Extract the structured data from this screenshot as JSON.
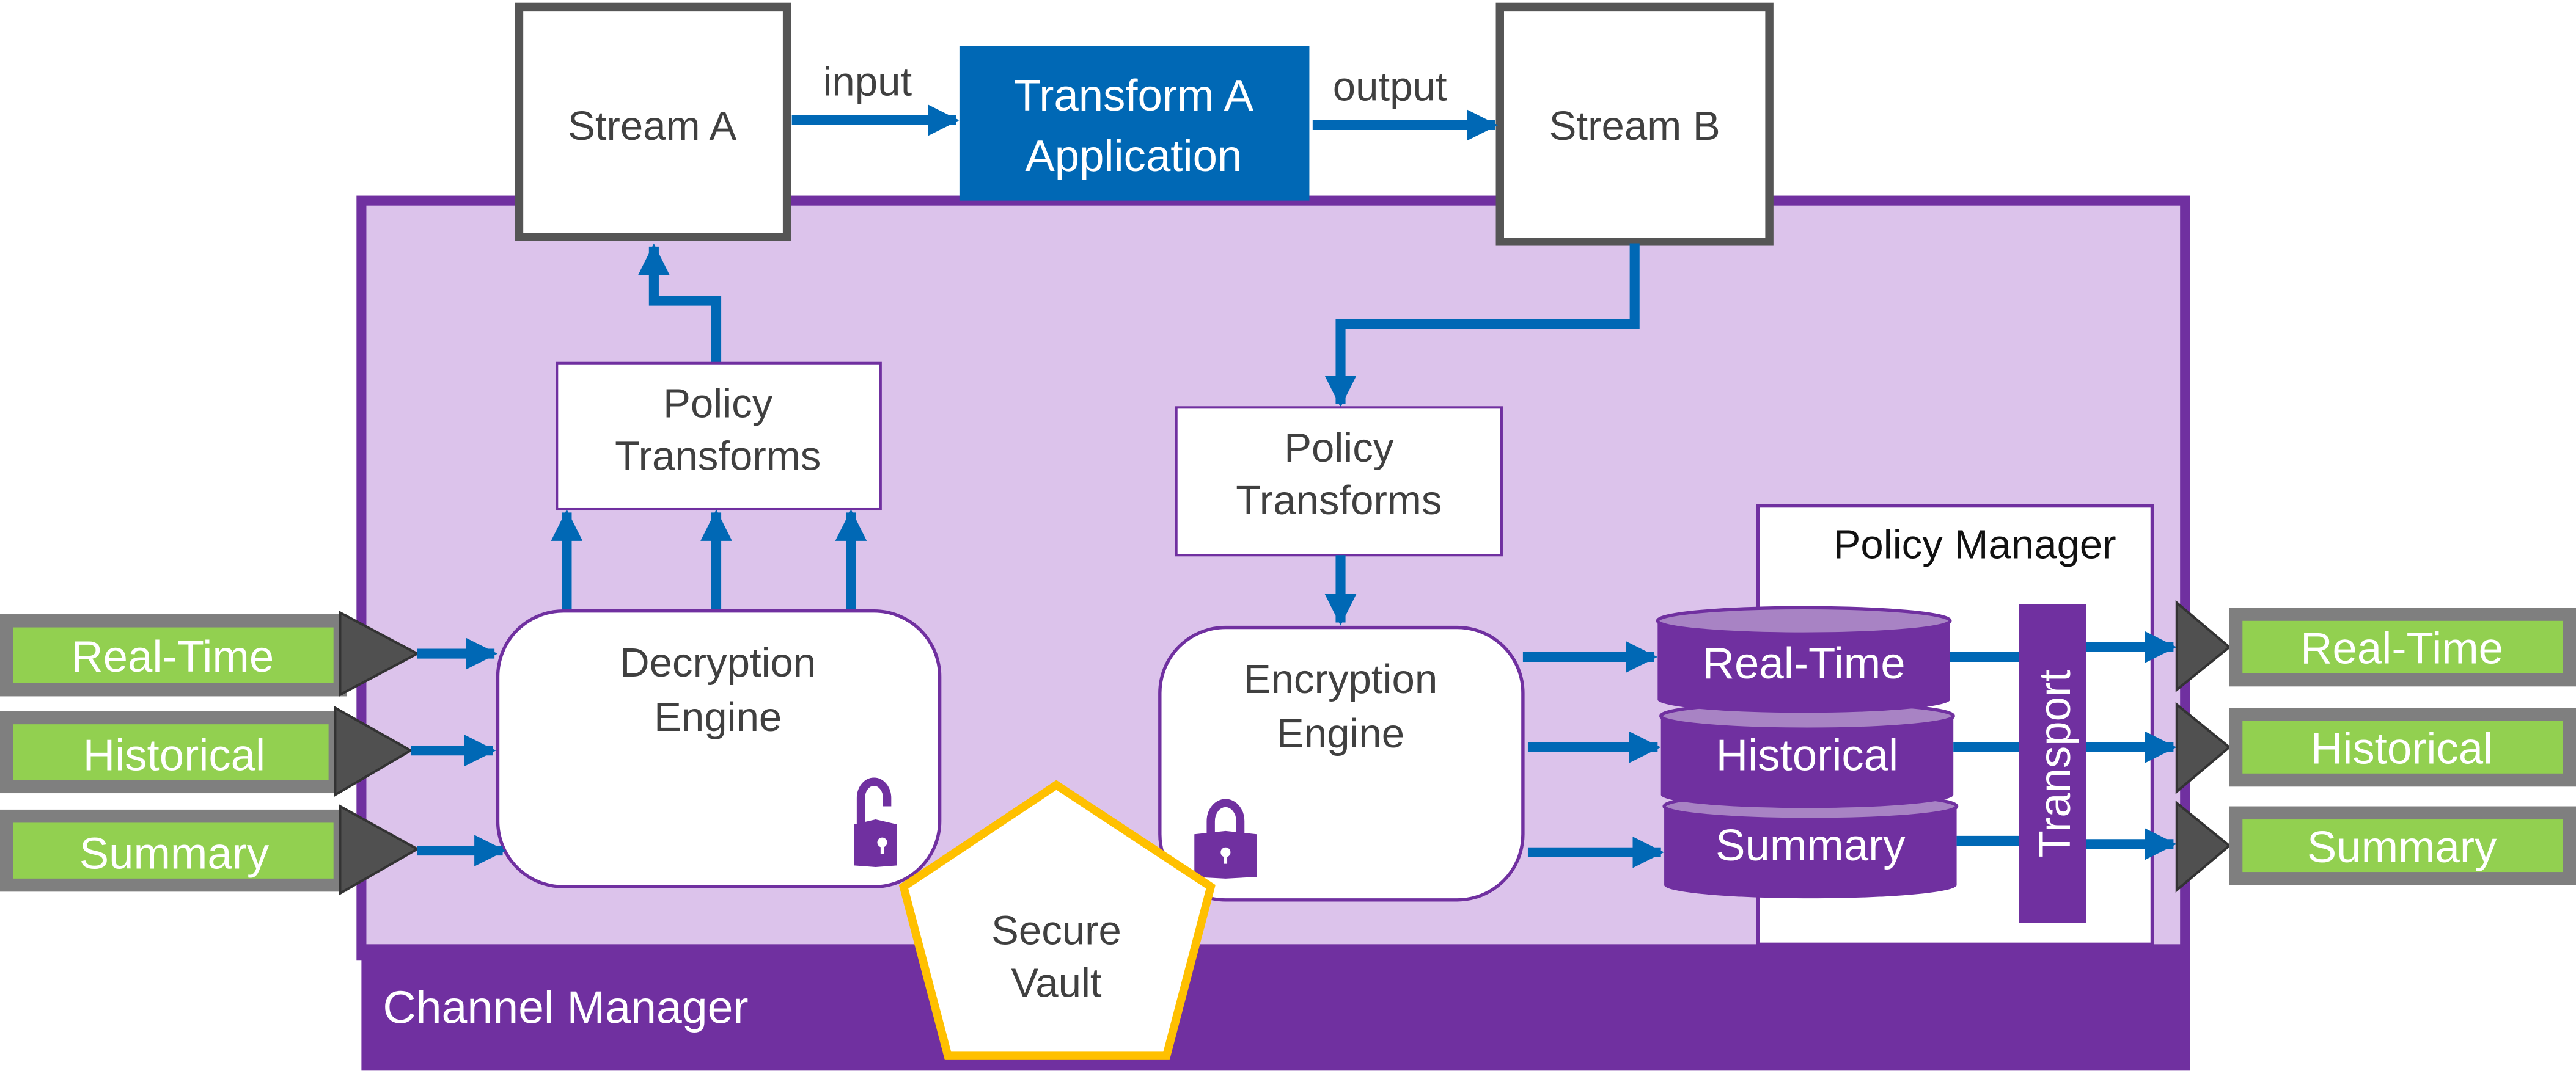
{
  "colors": {
    "purple": "#7030a0",
    "lavender": "#dcc3eb",
    "blue": "#0068b5",
    "green": "#92d050",
    "gray": "#7f7f7f",
    "dark": "#505050",
    "yellow": "#ffc000",
    "cylinder_top": "#a883c4"
  },
  "top": {
    "stream_a": "Stream A",
    "stream_b": "Stream B",
    "transform_line1": "Transform A",
    "transform_line2": "Application",
    "input_label": "input",
    "output_label": "output"
  },
  "channel_manager": {
    "label": "Channel Manager"
  },
  "policy_transforms_left": {
    "line1": "Policy",
    "line2": "Transforms"
  },
  "policy_transforms_right": {
    "line1": "Policy",
    "line2": "Transforms"
  },
  "decryption": {
    "line1": "Decryption",
    "line2": "Engine",
    "lock_icon": "lock-open-icon"
  },
  "encryption": {
    "line1": "Encryption",
    "line2": "Engine",
    "lock_icon": "lock-closed-icon"
  },
  "vault": {
    "line1": "Secure",
    "line2": "Vault"
  },
  "policy_manager": {
    "label": "Policy Manager",
    "transport": "Transport",
    "stores": [
      "Real-Time",
      "Historical",
      "Summary"
    ]
  },
  "inputs": [
    "Real-Time",
    "Historical",
    "Summary"
  ],
  "outputs": [
    "Real-Time",
    "Historical",
    "Summary"
  ]
}
